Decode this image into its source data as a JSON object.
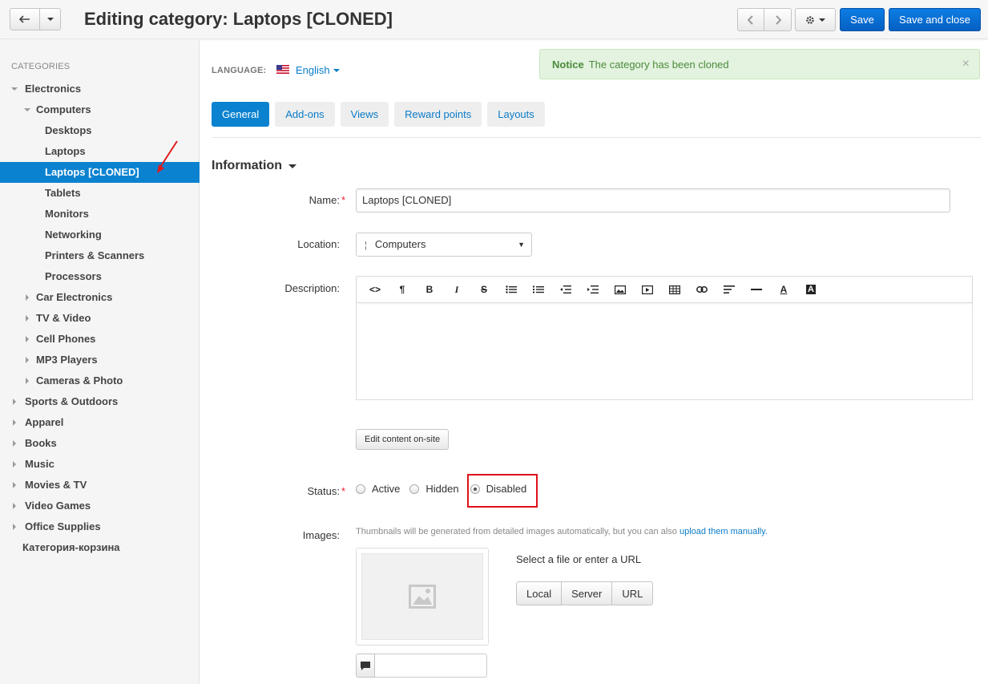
{
  "header": {
    "title": "Editing category: Laptops [CLONED]",
    "save_label": "Save",
    "save_close_label": "Save and close"
  },
  "sidebar": {
    "heading": "CATEGORIES",
    "items": [
      {
        "label": "Electronics",
        "level": 0,
        "toggle": "open"
      },
      {
        "label": "Computers",
        "level": 1,
        "toggle": "open"
      },
      {
        "label": "Desktops",
        "level": 2,
        "toggle": "none"
      },
      {
        "label": "Laptops",
        "level": 2,
        "toggle": "none"
      },
      {
        "label": "Laptops [CLONED]",
        "level": 2,
        "toggle": "none",
        "active": true
      },
      {
        "label": "Tablets",
        "level": 2,
        "toggle": "none"
      },
      {
        "label": "Monitors",
        "level": 2,
        "toggle": "none"
      },
      {
        "label": "Networking",
        "level": 2,
        "toggle": "none"
      },
      {
        "label": "Printers & Scanners",
        "level": 2,
        "toggle": "none"
      },
      {
        "label": "Processors",
        "level": 2,
        "toggle": "none"
      },
      {
        "label": "Car Electronics",
        "level": 1,
        "toggle": "closed"
      },
      {
        "label": "TV & Video",
        "level": 1,
        "toggle": "closed"
      },
      {
        "label": "Cell Phones",
        "level": 1,
        "toggle": "closed"
      },
      {
        "label": "MP3 Players",
        "level": 1,
        "toggle": "closed"
      },
      {
        "label": "Cameras & Photo",
        "level": 1,
        "toggle": "closed"
      },
      {
        "label": "Sports & Outdoors",
        "level": 0,
        "toggle": "closed"
      },
      {
        "label": "Apparel",
        "level": 0,
        "toggle": "closed"
      },
      {
        "label": "Books",
        "level": 0,
        "toggle": "closed"
      },
      {
        "label": "Music",
        "level": 0,
        "toggle": "closed"
      },
      {
        "label": "Movies & TV",
        "level": 0,
        "toggle": "closed"
      },
      {
        "label": "Video Games",
        "level": 0,
        "toggle": "closed"
      },
      {
        "label": "Office Supplies",
        "level": 0,
        "toggle": "closed"
      },
      {
        "label": "Категория-корзина",
        "level": 0,
        "toggle": "none"
      }
    ]
  },
  "language": {
    "label": "LANGUAGE:",
    "value": "English"
  },
  "notice": {
    "title": "Notice",
    "message": "The category has been cloned",
    "close": "×"
  },
  "tabs": [
    "General",
    "Add-ons",
    "Views",
    "Reward points",
    "Layouts"
  ],
  "section": {
    "title": "Information"
  },
  "form": {
    "name_label": "Name:",
    "name_value": "Laptops [CLONED]",
    "location_label": "Location:",
    "location_prefix": "¦",
    "location_value": "Computers",
    "description_label": "Description:",
    "edit_onsite_label": "Edit content on-site",
    "status_label": "Status:",
    "status_options": [
      "Active",
      "Hidden",
      "Disabled"
    ],
    "status_selected": "Disabled",
    "images_label": "Images:",
    "images_hint": "Thumbnails will be generated from detailed images automatically, but you can also",
    "images_hint_link": "upload them manually.",
    "select_file_text": "Select a file or enter a URL",
    "file_buttons": [
      "Local",
      "Server",
      "URL"
    ],
    "required_mark": "*"
  },
  "editor_toolbar": [
    "code-view",
    "paragraph",
    "bold",
    "italic",
    "strikethrough",
    "bulleted-list",
    "numbered-list",
    "outdent",
    "indent",
    "image",
    "video",
    "table",
    "link",
    "align",
    "horizontal-rule",
    "font-color",
    "background-color"
  ],
  "colors": {
    "accent": "#0b82d0",
    "primary_button": "#0d7de4",
    "notice_bg": "#e3f3df",
    "highlight": "#e0101a"
  }
}
